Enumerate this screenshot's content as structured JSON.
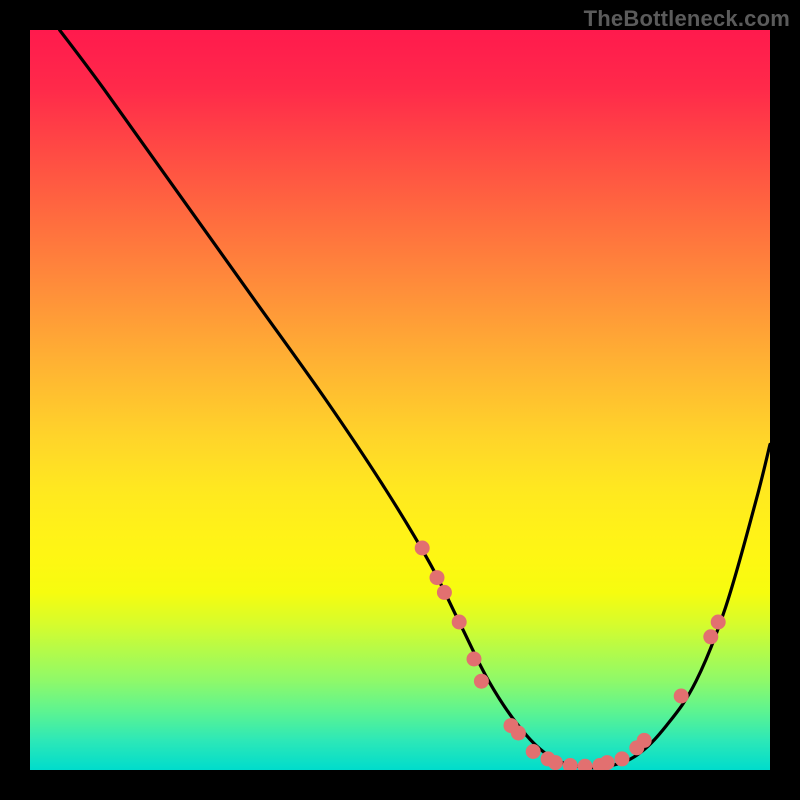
{
  "watermark": "TheBottleneck.com",
  "chart_data": {
    "type": "line",
    "title": "",
    "xlabel": "",
    "ylabel": "",
    "xlim": [
      0,
      100
    ],
    "ylim": [
      0,
      100
    ],
    "series": [
      {
        "name": "curve",
        "x": [
          4,
          10,
          20,
          30,
          40,
          48,
          54,
          58,
          62,
          66,
          70,
          74,
          78,
          82,
          86,
          90,
          94,
          98,
          100
        ],
        "y": [
          100,
          92,
          78,
          64,
          50,
          38,
          28,
          20,
          12,
          6,
          2,
          0.5,
          0.5,
          2,
          6,
          12,
          22,
          36,
          44
        ]
      }
    ],
    "markers": [
      {
        "x": 53,
        "y": 30
      },
      {
        "x": 55,
        "y": 26
      },
      {
        "x": 56,
        "y": 24
      },
      {
        "x": 58,
        "y": 20
      },
      {
        "x": 60,
        "y": 15
      },
      {
        "x": 61,
        "y": 12
      },
      {
        "x": 65,
        "y": 6
      },
      {
        "x": 66,
        "y": 5
      },
      {
        "x": 68,
        "y": 2.5
      },
      {
        "x": 70,
        "y": 1.5
      },
      {
        "x": 71,
        "y": 1
      },
      {
        "x": 73,
        "y": 0.6
      },
      {
        "x": 75,
        "y": 0.5
      },
      {
        "x": 77,
        "y": 0.6
      },
      {
        "x": 78,
        "y": 1
      },
      {
        "x": 80,
        "y": 1.5
      },
      {
        "x": 82,
        "y": 3
      },
      {
        "x": 83,
        "y": 4
      },
      {
        "x": 88,
        "y": 10
      },
      {
        "x": 92,
        "y": 18
      },
      {
        "x": 93,
        "y": 20
      }
    ],
    "marker_color": "#e27070",
    "curve_color": "#000000"
  }
}
